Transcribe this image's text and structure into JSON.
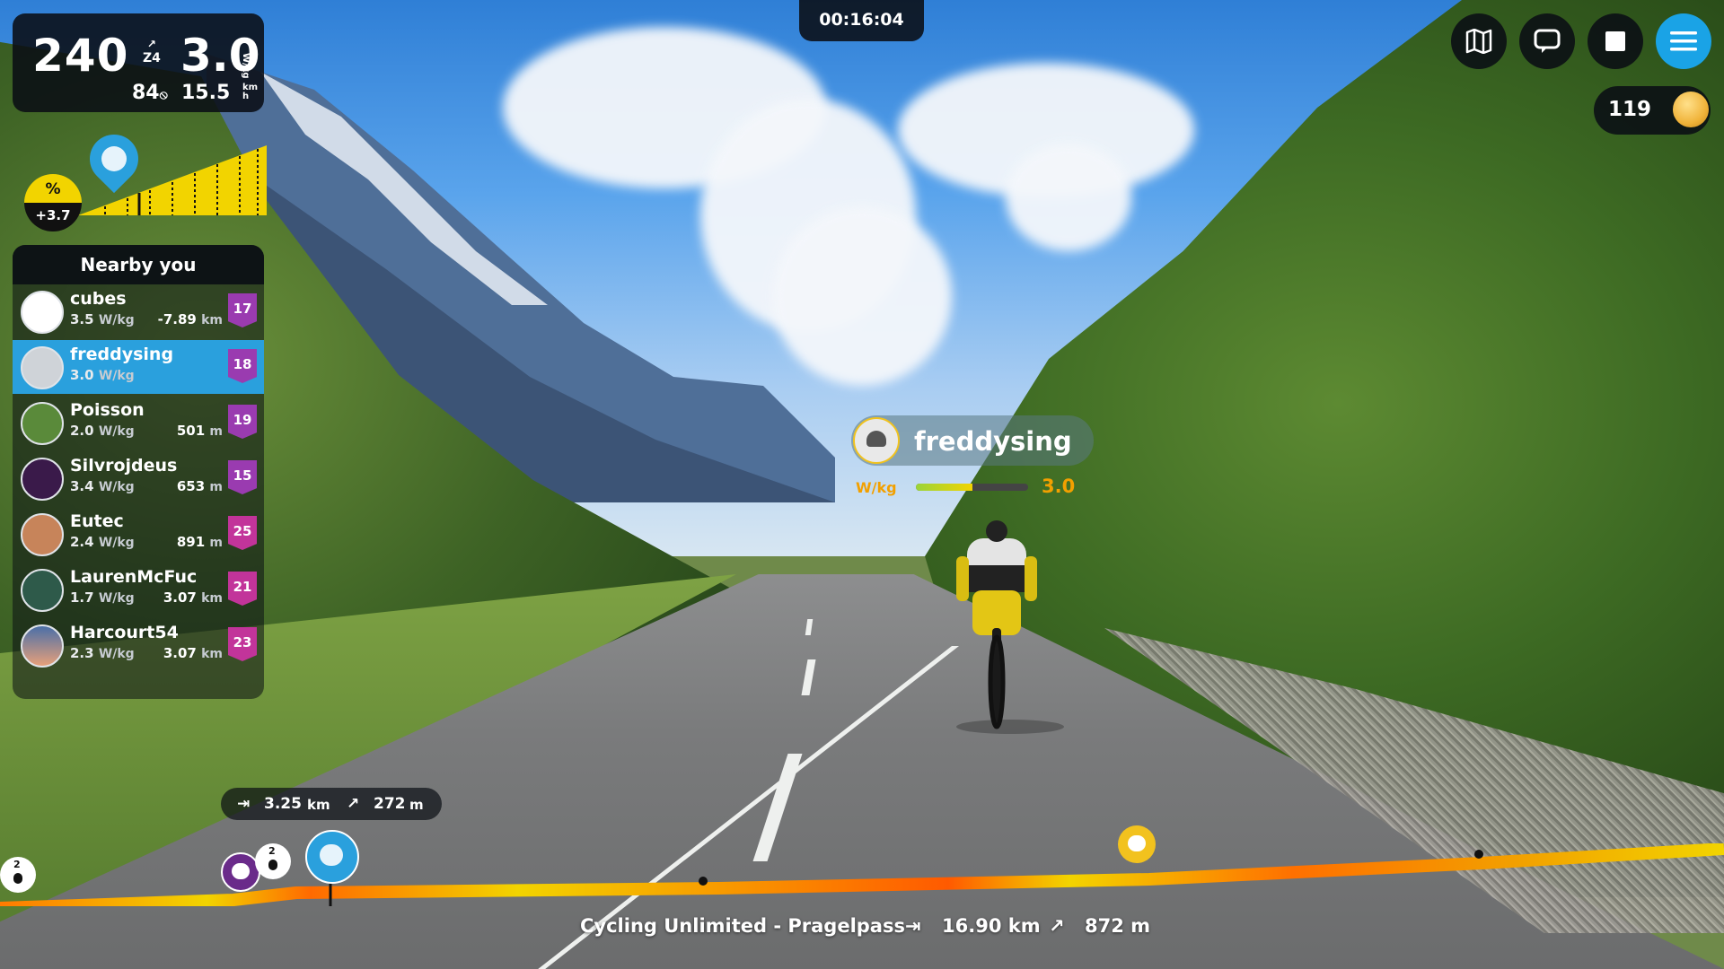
{
  "power_panel": {
    "watts": "240",
    "zone": "Z4",
    "wkg": "3.0",
    "wkg_unit": "W/kg",
    "cadence": "84",
    "speed": "15.5",
    "speed_unit_top": "km",
    "speed_unit_bottom": "h"
  },
  "timer": "00:16:04",
  "coins": "119",
  "gradient": {
    "label": "%",
    "value": "+3.7"
  },
  "nearby": {
    "title": "Nearby you",
    "riders": [
      {
        "name": "cubes",
        "wkg": "3.5",
        "wkg_unit": "W/kg",
        "distance": "-7.89",
        "distance_unit": "km",
        "level": "17",
        "active": false
      },
      {
        "name": "freddysing",
        "wkg": "3.0",
        "wkg_unit": "W/kg",
        "distance": "",
        "distance_unit": "",
        "level": "18",
        "active": true
      },
      {
        "name": "Poisson",
        "wkg": "2.0",
        "wkg_unit": "W/kg",
        "distance": "501",
        "distance_unit": "m",
        "level": "19",
        "active": false
      },
      {
        "name": "Silvrojdeus",
        "wkg": "3.4",
        "wkg_unit": "W/kg",
        "distance": "653",
        "distance_unit": "m",
        "level": "15",
        "active": false
      },
      {
        "name": "Eutec",
        "wkg": "2.4",
        "wkg_unit": "W/kg",
        "distance": "891",
        "distance_unit": "m",
        "level": "25",
        "active": false
      },
      {
        "name": "LaurenMcFuc",
        "wkg": "1.7",
        "wkg_unit": "W/kg",
        "distance": "3.07",
        "distance_unit": "km",
        "level": "21",
        "active": false
      },
      {
        "name": "Harcourt54",
        "wkg": "2.3",
        "wkg_unit": "W/kg",
        "distance": "3.07",
        "distance_unit": "km",
        "level": "23",
        "active": false
      }
    ]
  },
  "rider_tag": {
    "name": "freddysing",
    "wkg_label": "W/kg",
    "wkg_value": "3.0",
    "wkg_fraction": 0.5
  },
  "distance_pill": {
    "remaining": "3.25",
    "remaining_unit": "km",
    "climb": "272",
    "climb_unit": "m"
  },
  "course": {
    "name": "Cycling Unlimited - Pragelpass",
    "distance": "16.90 km",
    "elevation": "872 m"
  },
  "strip_markers": [
    "2",
    "2"
  ],
  "icons": {
    "map": "map-icon",
    "chat": "chat-icon",
    "stop": "stop-icon",
    "menu": "menu-icon",
    "coin": "coin-icon"
  },
  "colors": {
    "accent": "#1aa3e6",
    "level": "#9a3bb0",
    "grade_yellow": "#f2d400",
    "wkg_orange": "#f2a000"
  }
}
